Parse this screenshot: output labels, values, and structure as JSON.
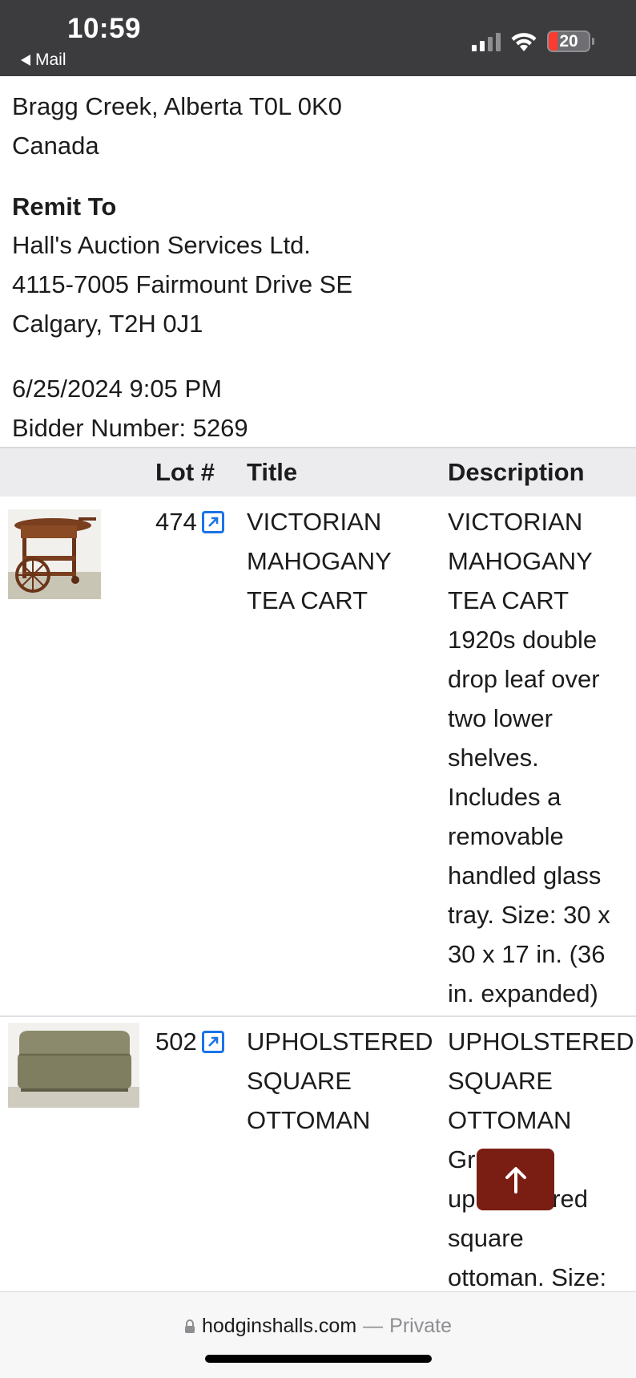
{
  "status_bar": {
    "time": "10:59",
    "back_app": "Mail",
    "battery": "20",
    "battery_color": "#ff3b30"
  },
  "address": {
    "line1": "Bragg Creek, Alberta T0L 0K0",
    "line2": "Canada"
  },
  "remit": {
    "heading": "Remit To",
    "name": "Hall's Auction Services Ltd.",
    "street": "4115-7005 Fairmount Drive SE",
    "city": "Calgary, T2H 0J1"
  },
  "meta": {
    "datetime": "6/25/2024 9:05 PM",
    "bidder": "Bidder Number: 5269"
  },
  "table": {
    "headers": {
      "lot": "Lot #",
      "title": "Title",
      "description": "Description"
    },
    "rows": [
      {
        "lot": "474",
        "title_lines": [
          "VICTORIAN",
          "MAHOGANY",
          "TEA CART"
        ],
        "description_lines": [
          "VICTORIAN",
          "MAHOGANY",
          "TEA CART",
          "1920s double",
          "drop leaf over",
          "two lower",
          "shelves.",
          "Includes a",
          "removable",
          "handled glass",
          "tray. Size: 30 x",
          "30 x 17 in. (36",
          "in. expanded)"
        ]
      },
      {
        "lot": "502",
        "title_lines": [
          "UPHOLSTERED",
          "SQUARE",
          "OTTOMAN"
        ],
        "description_lines": [
          "UPHOLSTERED",
          "SQUARE",
          "OTTOMAN",
          "Gr",
          "up",
          "red",
          "square",
          "ottoman. Size:"
        ]
      }
    ]
  },
  "browser": {
    "domain": "hodginshalls.com",
    "separator": "—",
    "mode": "Private"
  },
  "icons": [
    "back-arrow-icon",
    "signal-icon",
    "wifi-icon",
    "battery-icon",
    "external-link-icon",
    "arrow-up-icon",
    "lock-icon"
  ],
  "colors": {
    "accent": "#1a73e8",
    "scroll_button": "#7a1d12",
    "status_bar": "#3c3c3e"
  }
}
